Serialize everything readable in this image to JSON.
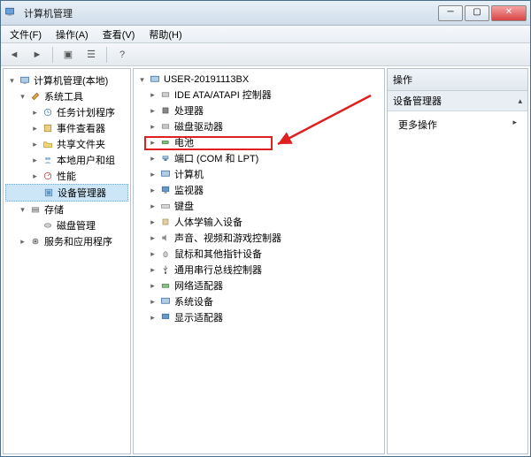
{
  "window": {
    "title": "计算机管理"
  },
  "menu": {
    "file": "文件(F)",
    "action": "操作(A)",
    "view": "查看(V)",
    "help": "帮助(H)"
  },
  "left_tree": {
    "root": "计算机管理(本地)",
    "system_tools": "系统工具",
    "task_scheduler": "任务计划程序",
    "event_viewer": "事件查看器",
    "shared_folders": "共享文件夹",
    "local_users": "本地用户和组",
    "performance": "性能",
    "device_manager": "设备管理器",
    "storage": "存储",
    "disk_mgmt": "磁盘管理",
    "services_apps": "服务和应用程序"
  },
  "center_tree": {
    "root": "USER-20191113BX",
    "ide": "IDE ATA/ATAPI 控制器",
    "processors": "处理器",
    "disk_drives": "磁盘驱动器",
    "batteries": "电池",
    "ports": "端口 (COM 和 LPT)",
    "computer": "计算机",
    "monitors": "监视器",
    "keyboards": "键盘",
    "hid": "人体学输入设备",
    "sound": "声音、视频和游戏控制器",
    "mice": "鼠标和其他指针设备",
    "usb": "通用串行总线控制器",
    "network": "网络适配器",
    "system_devices": "系统设备",
    "display": "显示适配器"
  },
  "right": {
    "header": "操作",
    "sub": "设备管理器",
    "more": "更多操作"
  }
}
